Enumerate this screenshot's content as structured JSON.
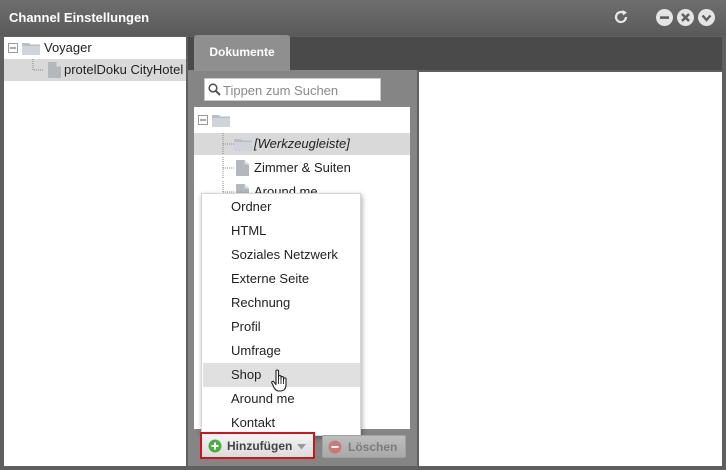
{
  "window": {
    "title": "Channel Einstellungen"
  },
  "channels": {
    "items": [
      {
        "label": "Voyager"
      },
      {
        "label": "protelDoku CityHotel"
      }
    ]
  },
  "tabs": [
    {
      "label": "Dokumente"
    }
  ],
  "search": {
    "placeholder": "Tippen zum Suchen",
    "value": ""
  },
  "document_tree": {
    "items": [
      {
        "label": "[Werkzeugleiste]"
      },
      {
        "label": "Zimmer & Suiten"
      },
      {
        "label": "Around me"
      }
    ]
  },
  "add_menu": {
    "items": [
      {
        "label": "Ordner"
      },
      {
        "label": "HTML"
      },
      {
        "label": "Soziales Netzwerk"
      },
      {
        "label": "Externe Seite"
      },
      {
        "label": "Rechnung"
      },
      {
        "label": "Profil"
      },
      {
        "label": "Umfrage"
      },
      {
        "label": "Shop"
      },
      {
        "label": "Around me"
      },
      {
        "label": "Kontakt"
      }
    ]
  },
  "buttons": {
    "add_label": "Hinzufügen",
    "delete_label": "Löschen"
  },
  "colors": {
    "add_highlight_border": "#d0141b",
    "add_icon": "#4caf3d",
    "delete_icon": "#d9534f"
  }
}
